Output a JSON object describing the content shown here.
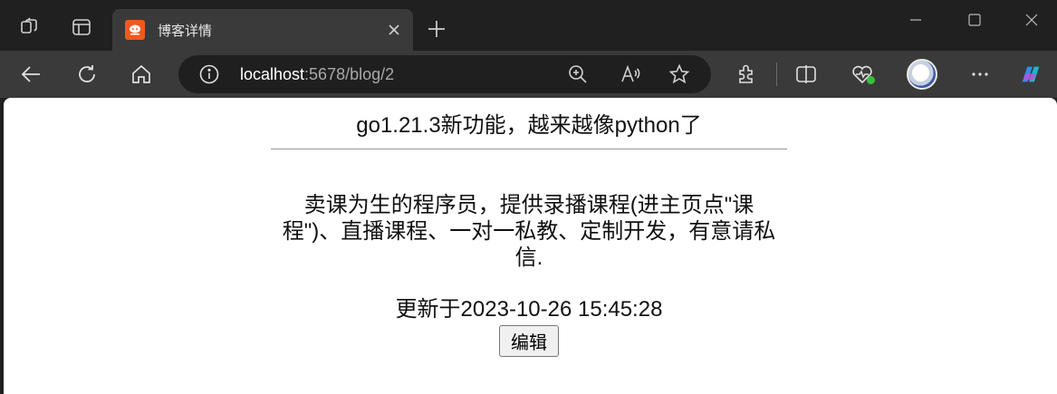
{
  "browser": {
    "tab": {
      "title": "博客详情"
    },
    "address_bar": {
      "host": "localhost",
      "path": ":5678/blog/2"
    }
  },
  "blog": {
    "title": "go1.21.3新功能，越来越像python了",
    "body": "卖课为生的程序员，提供录播课程(进主页点\"课程\")、直播课程、一对一私教、定制开发，有意请私信.",
    "updated": "更新于2023-10-26 15:45:28",
    "edit_label": "编辑"
  }
}
